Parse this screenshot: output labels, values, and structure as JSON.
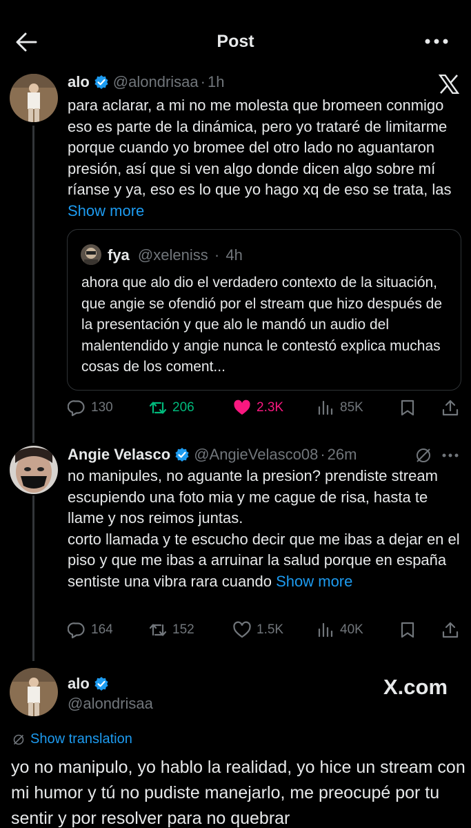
{
  "header": {
    "title": "Post"
  },
  "colors": {
    "accent": "#1d9bf0",
    "retweet": "#00ba7c",
    "like": "#f91880",
    "muted": "#71767b",
    "text": "#e7e9ea"
  },
  "post1": {
    "name": "alo",
    "handle": "@alondrisaa",
    "time": "1h",
    "text": "para aclarar, a mi no me molesta que bromeen conmigo eso es parte de la dinámica, pero yo trataré de limitarme porque cuando yo bromee del otro lado no aguantaron presión, así que si ven algo donde dicen algo sobre mí ríanse y ya, eso es lo que yo hago xq de eso se trata, las",
    "show_more": "Show more",
    "quote": {
      "name": "fya",
      "handle": "@xeleniss",
      "time": "4h",
      "text": "ahora que alo dio el verdadero contexto de la situación, que angie se ofendió por el stream que hizo después de la presentación y que alo le mandó un audio del malentendido y angie nunca le contestó explica muchas cosas de los coment..."
    },
    "stats": {
      "replies": "130",
      "reposts": "206",
      "likes": "2.3K",
      "views": "85K"
    }
  },
  "post2": {
    "name": "Angie Velasco",
    "handle": "@AngieVelasco08",
    "time": "26m",
    "text": "no manipules, no aguante la presion? prendiste stream escupiendo una foto mia y me cague de risa, hasta te llame y nos reimos juntas.\ncorto llamada y te escucho decir que me ibas a dejar en el piso y que me ibas a arruinar la salud porque en españa sentiste una vibra rara cuando",
    "show_more": "Show more",
    "stats": {
      "replies": "164",
      "reposts": "152",
      "likes": "1.5K",
      "views": "40K"
    }
  },
  "post3": {
    "name": "alo",
    "handle": "@alondrisaa",
    "show_translation": "Show translation",
    "text": "yo no manipulo, yo hablo la realidad, yo hice un stream con mi humor y tú no pudiste manejarlo, me preocupé por tu sentir y por resolver para no quebrar"
  },
  "watermark": "X.com",
  "icons": [
    "back-arrow-icon",
    "more-icon",
    "verified-icon",
    "x-logo-icon",
    "reply-icon",
    "repost-icon",
    "like-icon",
    "views-icon",
    "bookmark-icon",
    "share-icon",
    "translate-icon"
  ]
}
